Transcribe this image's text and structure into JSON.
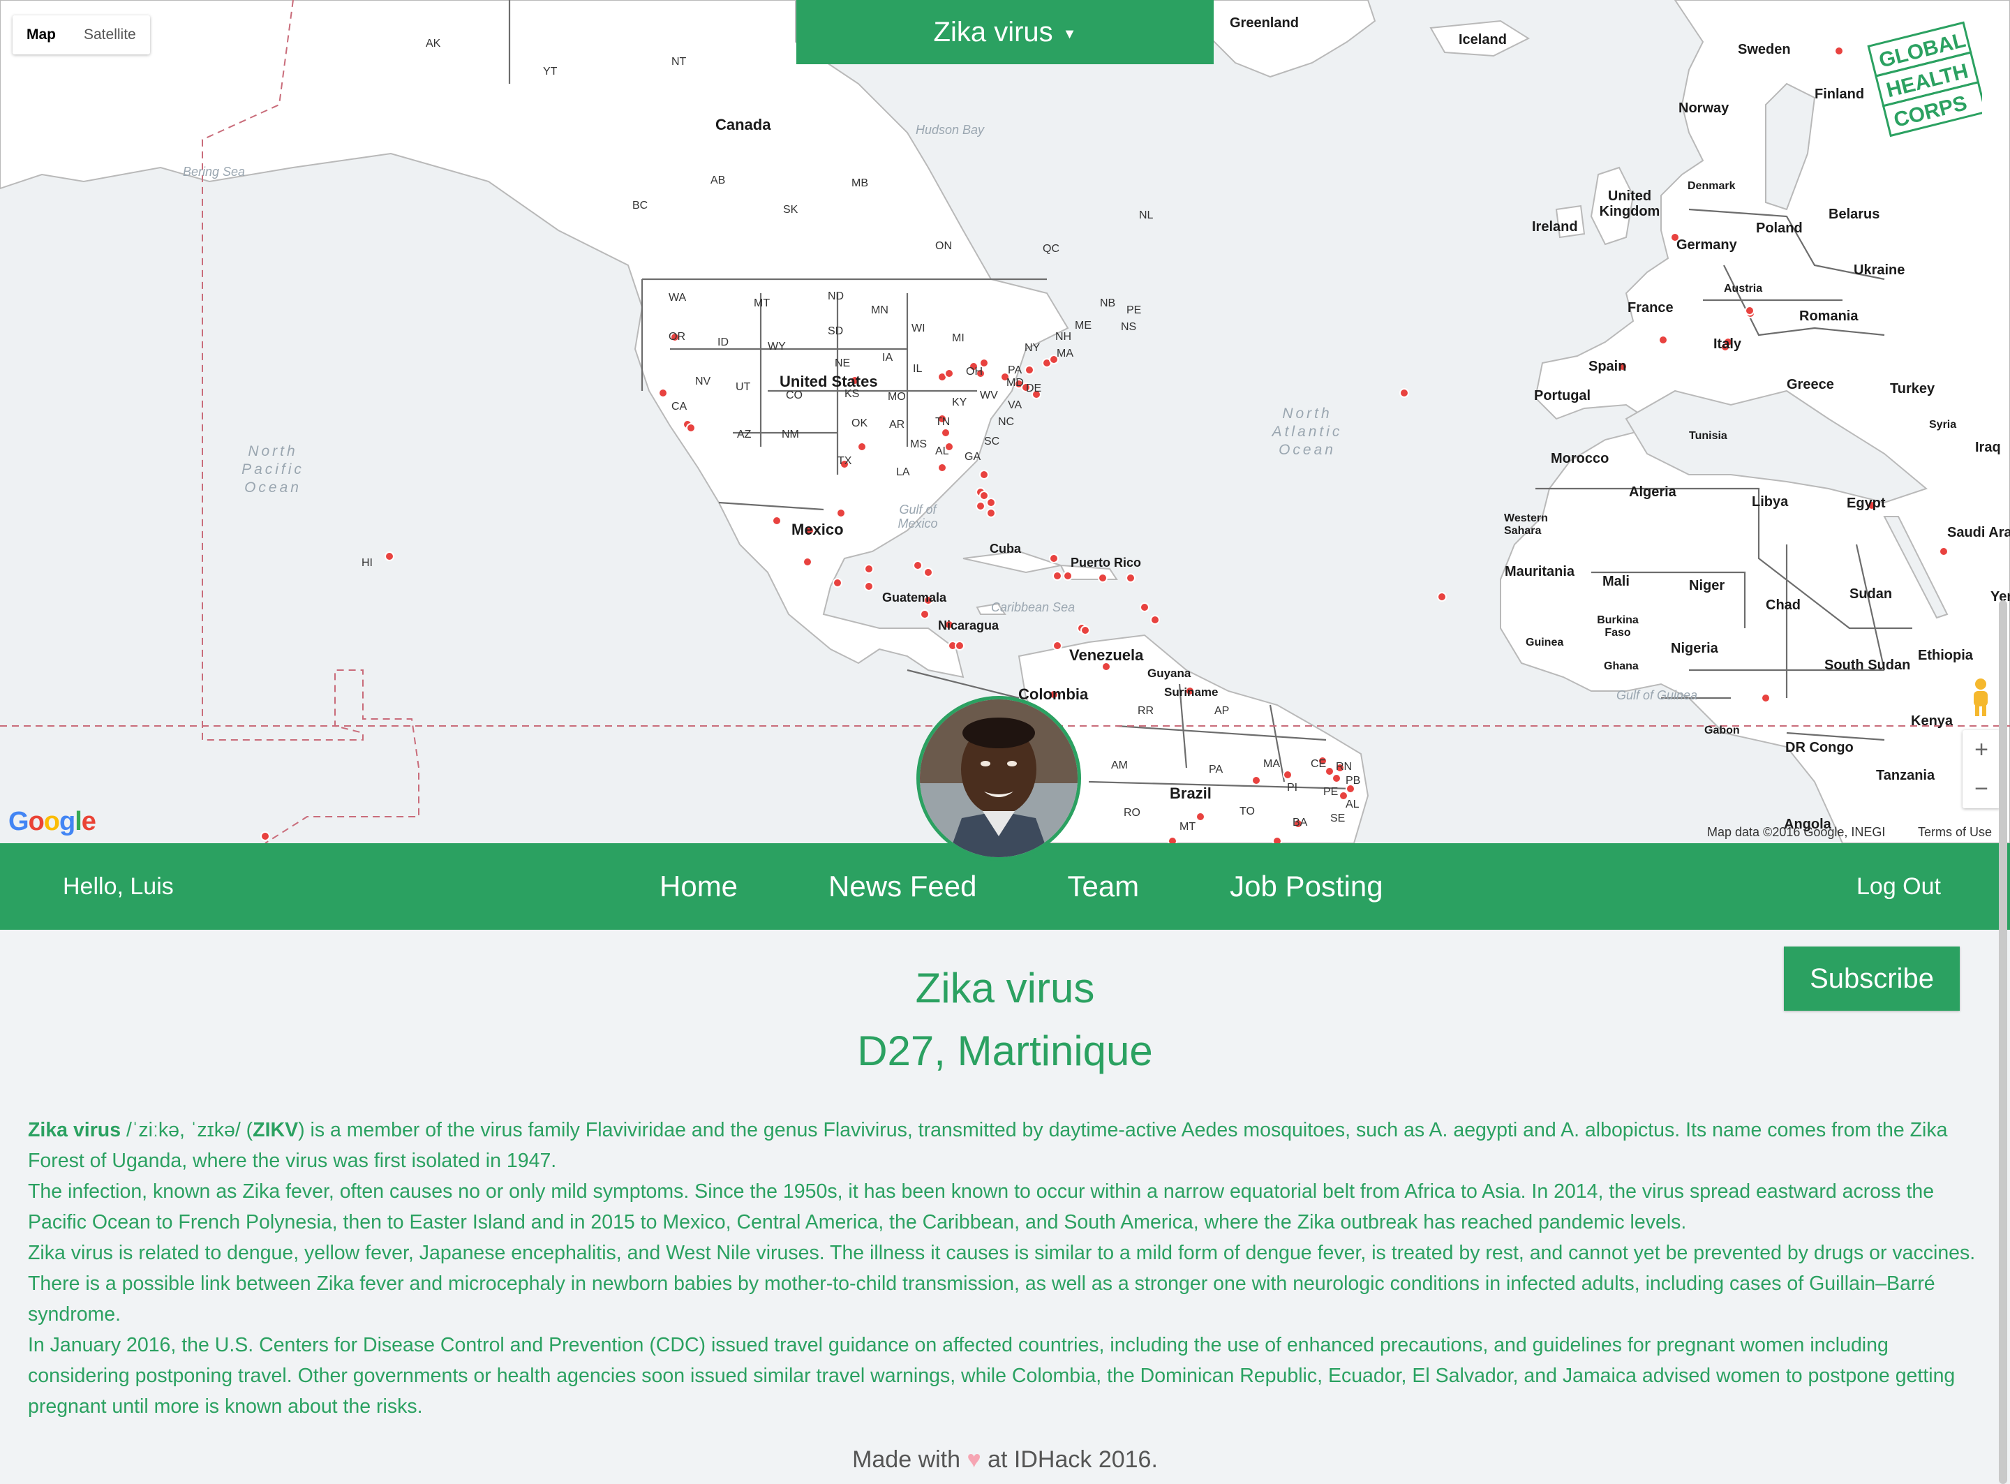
{
  "map": {
    "type_controls": [
      {
        "label": "Map",
        "active": true
      },
      {
        "label": "Satellite",
        "active": false
      }
    ],
    "selected_virus": "Zika virus",
    "logo_text": [
      "GLOBAL",
      "HEALTH",
      "CORPS"
    ],
    "google_logo": "Google",
    "attribution": "Map data ©2016 Google, INEGI",
    "terms": "Terms of Use",
    "zoom_in": "+",
    "zoom_out": "−",
    "labels": {
      "countries": [
        "Canada",
        "United States",
        "Mexico",
        "Cuba",
        "Puerto Rico",
        "Guatemala",
        "Nicaragua",
        "Venezuela",
        "Colombia",
        "Guyana",
        "Suriname",
        "Brazil",
        "Greenland",
        "Iceland",
        "Sweden",
        "Norway",
        "Finland",
        "Denmark",
        "United Kingdom",
        "Ireland",
        "Germany",
        "Poland",
        "Belarus",
        "Ukraine",
        "Austria",
        "France",
        "Romania",
        "Spain",
        "Italy",
        "Portugal",
        "Greece",
        "Turkey",
        "Syria",
        "Iraq",
        "Morocco",
        "Tunisia",
        "Algeria",
        "Libya",
        "Egypt",
        "Saudi Ara",
        "Western Sahara",
        "Mauritania",
        "Mali",
        "Niger",
        "Chad",
        "Sudan",
        "Yem",
        "Burkina Faso",
        "Guinea",
        "Ghana",
        "Nigeria",
        "South Sudan",
        "Ethiopia",
        "Gabon",
        "DR Congo",
        "Kenya",
        "Tanzania",
        "Angola"
      ],
      "regions": [
        "AK",
        "YT",
        "NT",
        "BC",
        "AB",
        "SK",
        "MB",
        "ON",
        "QC",
        "NL",
        "NB",
        "PE",
        "NS",
        "WA",
        "MT",
        "ND",
        "MN",
        "OR",
        "ID",
        "WY",
        "SD",
        "WI",
        "MI",
        "NY",
        "NE",
        "IA",
        "IL",
        "OH",
        "PA",
        "NV",
        "UT",
        "CO",
        "KS",
        "MO",
        "KY",
        "WV",
        "MD",
        "DE",
        "CA",
        "AZ",
        "NM",
        "OK",
        "AR",
        "TN",
        "VA",
        "NC",
        "SC",
        "GA",
        "MS",
        "AL",
        "TX",
        "LA",
        "NH",
        "MA",
        "ME",
        "HI",
        "RR",
        "AP",
        "AM",
        "PA",
        "MA",
        "CE",
        "RN",
        "PB",
        "PI",
        "PE",
        "AL",
        "SE",
        "TO",
        "RO",
        "MT",
        "BA"
      ],
      "seas": [
        "North Pacific Ocean",
        "North Atlantic Ocean",
        "Bering Sea",
        "Hudson Bay",
        "Gulf of Mexico",
        "Caribbean Sea",
        "Gulf of Guinea"
      ]
    },
    "marker_color": "#e8423f"
  },
  "nav": {
    "greeting": "Hello, Luis",
    "links": [
      "Home",
      "News Feed",
      "Team",
      "Job Posting"
    ],
    "logout": "Log Out"
  },
  "page": {
    "subscribe_label": "Subscribe",
    "title": "Zika virus",
    "location": "D27, Martinique",
    "paragraphs": {
      "p1_bold1": "Zika virus",
      "p1_ipa": " /ˈziːkə, ˈzɪkə/ (",
      "p1_bold2": "ZIKV",
      "p1_rest": ") is a member of the virus family Flaviviridae and the genus Flavivirus, transmitted by daytime-active Aedes mosquitoes, such as A. aegypti and A. albopictus. Its name comes from the Zika Forest of Uganda, where the virus was first isolated in 1947.",
      "p2": "The infection, known as Zika fever, often causes no or only mild symptoms. Since the 1950s, it has been known to occur within a narrow equatorial belt from Africa to Asia. In 2014, the virus spread eastward across the Pacific Ocean to French Polynesia, then to Easter Island and in 2015 to Mexico, Central America, the Caribbean, and South America, where the Zika outbreak has reached pandemic levels.",
      "p3": "Zika virus is related to dengue, yellow fever, Japanese encephalitis, and West Nile viruses. The illness it causes is similar to a mild form of dengue fever, is treated by rest, and cannot yet be prevented by drugs or vaccines. There is a possible link between Zika fever and microcephaly in newborn babies by mother-to-child transmission, as well as a stronger one with neurologic conditions in infected adults, including cases of Guillain–Barré syndrome.",
      "p4": "In January 2016, the U.S. Centers for Disease Control and Prevention (CDC) issued travel guidance on affected countries, including the use of enhanced precautions, and guidelines for pregnant women including considering postponing travel. Other governments or health agencies soon issued similar travel warnings, while Colombia, the Dominican Republic, Ecuador, El Salvador, and Jamaica advised women to postpone getting pregnant until more is known about the risks."
    },
    "footer": {
      "before": "Made with ",
      "heart": "♥",
      "after": " at IDHack 2016."
    }
  },
  "colors": {
    "brand": "#2ba161",
    "heart": "#f6a5b3",
    "map_water": "#eef1f3",
    "map_land": "#ffffff"
  }
}
